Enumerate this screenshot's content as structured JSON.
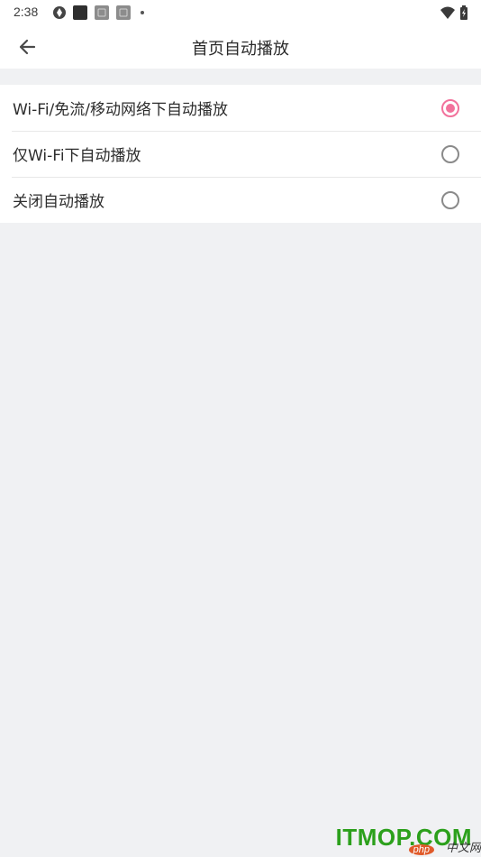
{
  "status_bar": {
    "time": "2:38",
    "left_icons": [
      "aperture-icon",
      "app-icon-dark",
      "app-icon-gray",
      "app-icon-gray",
      "dot-icon"
    ],
    "right_icons": [
      "wifi-icon",
      "battery-icon"
    ]
  },
  "app_bar": {
    "title": "首页自动播放",
    "back_icon": "arrow-left-icon"
  },
  "options": [
    {
      "label": "Wi-Fi/免流/移动网络下自动播放",
      "selected": true
    },
    {
      "label": "仅Wi-Fi下自动播放",
      "selected": false
    },
    {
      "label": "关闭自动播放",
      "selected": false
    }
  ],
  "colors": {
    "accent": "#f2729c",
    "background": "#f0f1f3",
    "surface": "#ffffff"
  },
  "watermark": {
    "main": "ITMOP.COM",
    "badge": "php",
    "suffix": "中文网"
  }
}
